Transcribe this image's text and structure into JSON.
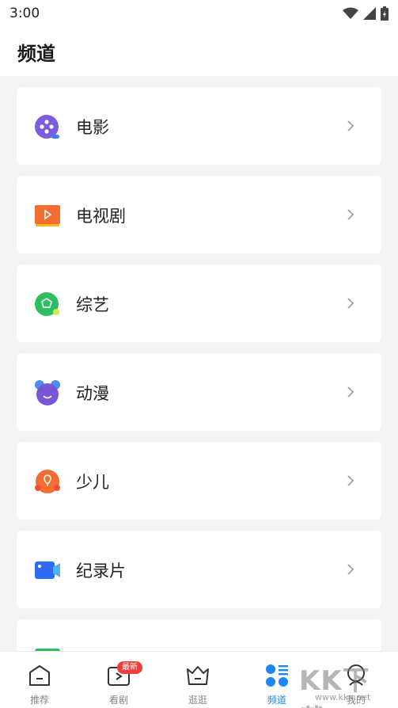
{
  "status_bar": {
    "time": "3:00"
  },
  "header": {
    "title": "频道"
  },
  "channels": [
    {
      "label": "电影",
      "icon": "film-icon"
    },
    {
      "label": "电视剧",
      "icon": "tv-series-icon"
    },
    {
      "label": "综艺",
      "icon": "variety-show-icon"
    },
    {
      "label": "动漫",
      "icon": "anime-icon"
    },
    {
      "label": "少儿",
      "icon": "kids-icon"
    },
    {
      "label": "纪录片",
      "icon": "documentary-icon"
    },
    {
      "label": "专题",
      "icon": "topic-icon"
    }
  ],
  "bottom_nav": {
    "items": [
      {
        "label": "推荐",
        "icon": "home-icon"
      },
      {
        "label": "看剧",
        "icon": "play-icon",
        "badge": "最新"
      },
      {
        "label": "逛逛",
        "icon": "browse-icon"
      },
      {
        "label": "频道",
        "icon": "channels-icon",
        "active": true
      },
      {
        "label": "我的",
        "icon": "profile-icon"
      }
    ]
  },
  "watermark": {
    "text": "KK下载",
    "sub": "www.kkx.net"
  },
  "colors": {
    "accent": "#1e88f0",
    "badge": "#f23b3b"
  }
}
